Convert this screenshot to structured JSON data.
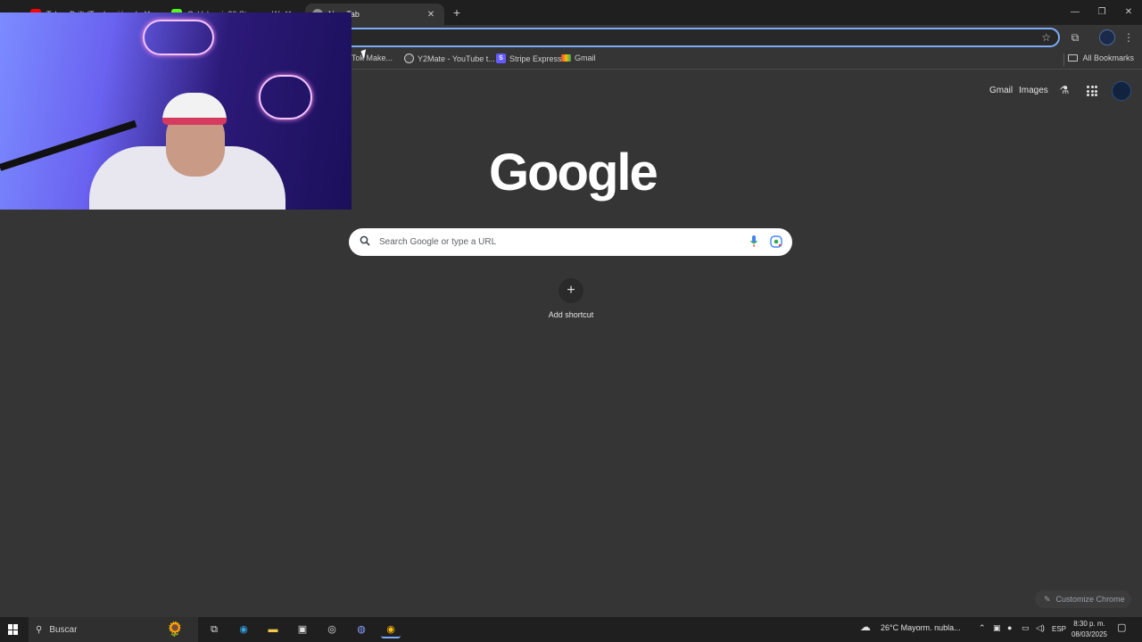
{
  "tabs": [
    {
      "title": "Tokyo Drift (Traducción al",
      "favicon_color": "#ff0000"
    },
    {
      "title": "CaValencia20 Stream - Watch",
      "favicon_color": "#53fc18"
    },
    {
      "title": "New Tab",
      "favicon_color": "#8e8e8e"
    }
  ],
  "bookmarks": [
    {
      "label": "Tok Make...",
      "favicon": "tiktok-icon"
    },
    {
      "label": "Y2Mate - YouTube t...",
      "favicon": "y2mate-icon",
      "glyph": "y2"
    },
    {
      "label": "Stripe Express",
      "favicon": "stripe-icon",
      "glyph": "S",
      "color": "#635bff"
    },
    {
      "label": "Gmail",
      "favicon": "gmail-icon"
    }
  ],
  "all_bookmarks": "All Bookmarks",
  "ntp": {
    "gmail": "Gmail",
    "images": "Images",
    "logo": "Google",
    "search_placeholder": "Search Google or type a URL",
    "add_shortcut": "Add shortcut",
    "customize": "Customize Chrome"
  },
  "taskbar": {
    "search": "Buscar",
    "weather": "26°C  Mayorm. nubla...",
    "lang": "ESP",
    "time": "8:30 p. m.",
    "date": "08/03/2025"
  },
  "colors": {
    "accent": "#7cacf8",
    "background": "#353535",
    "tabstrip": "#1f1f1f"
  }
}
